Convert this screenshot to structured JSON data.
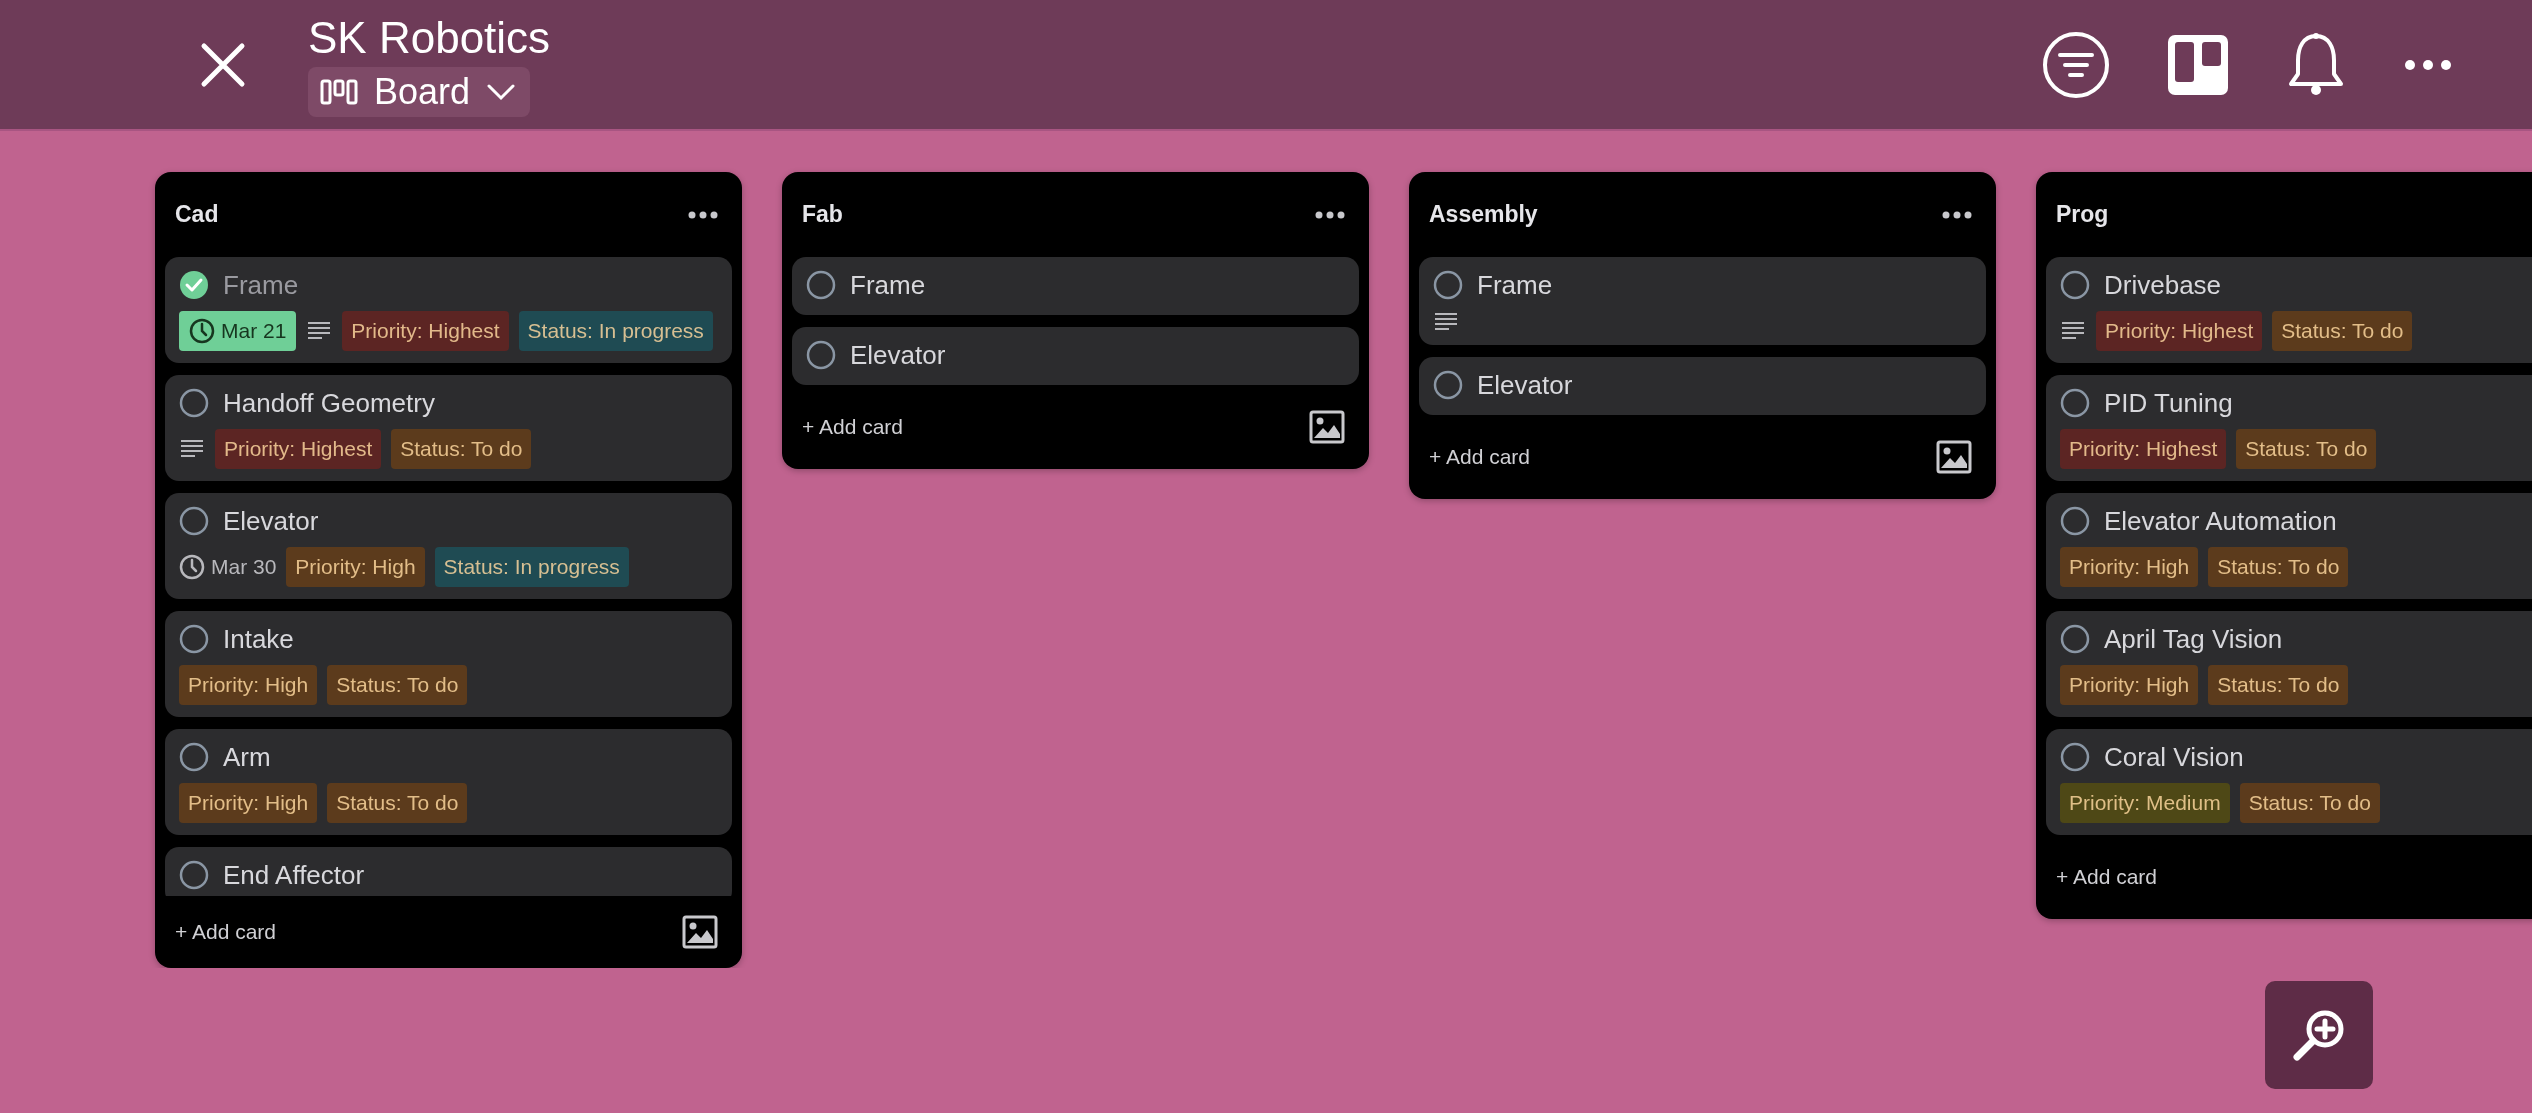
{
  "header": {
    "title": "SK Robotics",
    "view": "Board"
  },
  "columns": [
    {
      "title": "Cad",
      "menu": true,
      "image_button": true,
      "clipped": true,
      "add_label": "+ Add card",
      "cards": [
        {
          "title": "Frame",
          "checked": true,
          "date": {
            "text": "Mar 21",
            "complete": true
          },
          "description": true,
          "tags": [
            {
              "text": "Priority: Highest",
              "color": "#5c2523"
            },
            {
              "text": "Status: In progress",
              "color": "#1f4b53"
            }
          ]
        },
        {
          "title": "Handoff Geometry",
          "checked": false,
          "description": true,
          "tags": [
            {
              "text": "Priority: Highest",
              "color": "#5c2523"
            },
            {
              "text": "Status: To do",
              "color": "#5c3b1c"
            }
          ]
        },
        {
          "title": "Elevator",
          "checked": false,
          "date": {
            "text": "Mar 30",
            "complete": false
          },
          "tags": [
            {
              "text": "Priority: High",
              "color": "#5c3b1c"
            },
            {
              "text": "Status: In progress",
              "color": "#1f4b53"
            }
          ]
        },
        {
          "title": "Intake",
          "checked": false,
          "tags": [
            {
              "text": "Priority: High",
              "color": "#5c3b1c"
            },
            {
              "text": "Status: To do",
              "color": "#5c3b1c"
            }
          ]
        },
        {
          "title": "Arm",
          "checked": false,
          "tags": [
            {
              "text": "Priority: High",
              "color": "#5c3b1c"
            },
            {
              "text": "Status: To do",
              "color": "#5c3b1c"
            }
          ]
        },
        {
          "title": "End Affector",
          "checked": false
        }
      ]
    },
    {
      "title": "Fab",
      "menu": true,
      "image_button": true,
      "add_label": "+ Add card",
      "cards": [
        {
          "title": "Frame",
          "checked": false
        },
        {
          "title": "Elevator",
          "checked": false
        }
      ]
    },
    {
      "title": "Assembly",
      "menu": true,
      "image_button": true,
      "add_label": "+ Add card",
      "cards": [
        {
          "title": "Frame",
          "checked": false,
          "description": true
        },
        {
          "title": "Elevator",
          "checked": false
        }
      ]
    },
    {
      "title": "Prog",
      "add_label": "+ Add card",
      "cards": [
        {
          "title": "Drivebase",
          "checked": false,
          "description": true,
          "tags": [
            {
              "text": "Priority: Highest",
              "color": "#5c2523"
            },
            {
              "text": "Status: To do",
              "color": "#5c3b1c"
            }
          ]
        },
        {
          "title": "PID Tuning",
          "checked": false,
          "tags": [
            {
              "text": "Priority: Highest",
              "color": "#5c2523"
            },
            {
              "text": "Status: To do",
              "color": "#5c3b1c"
            }
          ]
        },
        {
          "title": "Elevator Automation",
          "checked": false,
          "tags": [
            {
              "text": "Priority: High",
              "color": "#5c3b1c"
            },
            {
              "text": "Status: To do",
              "color": "#5c3b1c"
            }
          ]
        },
        {
          "title": "April Tag Vision",
          "checked": false,
          "tags": [
            {
              "text": "Priority: High",
              "color": "#5c3b1c"
            },
            {
              "text": "Status: To do",
              "color": "#5c3b1c"
            }
          ]
        },
        {
          "title": "Coral Vision",
          "checked": false,
          "tags": [
            {
              "text": "Priority: Medium",
              "color": "#4e4816"
            },
            {
              "text": "Status: To do",
              "color": "#5c3b1c"
            }
          ]
        }
      ]
    }
  ]
}
